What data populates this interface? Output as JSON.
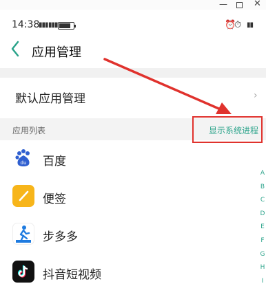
{
  "window": {
    "minimize_glyph": "—",
    "close_glyph": "✕"
  },
  "status": {
    "time": "14:38",
    "battery_level": 0.8,
    "icons": [
      "signal-icon",
      "signal-icon",
      "battery-icon",
      "alarm-icon",
      "clock-icon",
      "signal-icon"
    ]
  },
  "header": {
    "title": "应用管理",
    "back_icon": "chevron-left-icon",
    "accent_color": "#2aa38a"
  },
  "default_apps": {
    "label": "默认应用管理",
    "chevron": "›"
  },
  "section": {
    "label": "应用列表",
    "action_label": "显示系统进程"
  },
  "apps": [
    {
      "name": "百度",
      "icon": "baidu-icon"
    },
    {
      "name": "便签",
      "icon": "notes-icon"
    },
    {
      "name": "步多多",
      "icon": "step-icon"
    },
    {
      "name": "抖音短视频",
      "icon": "tiktok-icon"
    }
  ],
  "alpha_index": [
    "A",
    "B",
    "C",
    "D",
    "E",
    "F",
    "G",
    "H",
    "I"
  ],
  "annotation_color": "#e0322d"
}
